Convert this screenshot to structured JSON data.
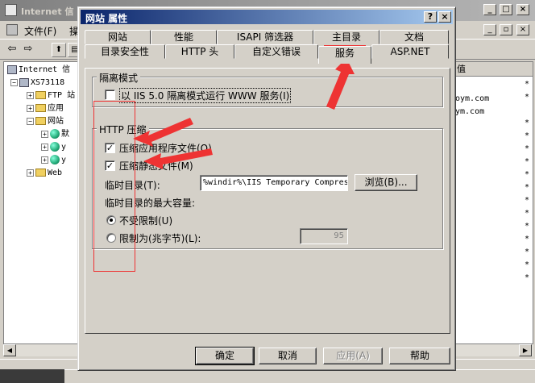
{
  "bg_window": {
    "title": "Internet 信",
    "menu": [
      "文件(F)",
      "操"
    ],
    "tree": [
      {
        "label": "Internet 信",
        "icon": "pc"
      },
      {
        "label": "XS73118",
        "icon": "pc"
      },
      {
        "label": "FTP 站",
        "icon": "folder"
      },
      {
        "label": "应用",
        "icon": "folder"
      },
      {
        "label": "网站",
        "icon": "folder"
      },
      {
        "label": "默",
        "icon": "globe"
      },
      {
        "label": "y",
        "icon": "globe"
      },
      {
        "label": "y",
        "icon": "globe"
      },
      {
        "label": "Web ",
        "icon": "folder"
      }
    ],
    "list_header": "值",
    "list_cells": [
      "*",
      "*",
      "oym.com",
      "ym.com",
      "*",
      "*",
      "*",
      "*",
      "*",
      "*",
      "*",
      "*",
      "*",
      "*",
      "*",
      "*",
      "*"
    ]
  },
  "dialog": {
    "title": "网站 属性",
    "help": "?",
    "close": "×",
    "tabs_row1": [
      "网站",
      "性能",
      "ISAPI 筛选器",
      "主目录",
      "文档"
    ],
    "tabs_row2": [
      "目录安全性",
      "HTTP 头",
      "自定义错误",
      "服务",
      "ASP.NET"
    ],
    "isolation": {
      "group_label": "隔离模式",
      "checkbox_label": "以 IIS 5.0 隔离模式运行 WWW 服务(I)",
      "checked": false
    },
    "compression": {
      "group_label": "HTTP 压缩",
      "compress_app_label": "压缩应用程序文件(O)",
      "compress_app_checked": true,
      "compress_static_label": "压缩静态文件(M)",
      "compress_static_checked": true,
      "temp_dir_label": "临时目录(T):",
      "temp_dir_value": "%windir%\\IIS Temporary Compres",
      "browse_label": "浏览(B)...",
      "max_size_label": "临时目录的最大容量:",
      "unlimited_label": "不受限制(U)",
      "limit_label": "限制为(兆字节)(L):",
      "limit_value": "95",
      "selected": "unlimited"
    },
    "buttons": {
      "ok": "确定",
      "cancel": "取消",
      "apply": "应用(A)",
      "help": "帮助"
    }
  },
  "colors": {
    "annotation": "#ee3333",
    "titlebar": "#0a246a",
    "face": "#d4d0c8"
  }
}
